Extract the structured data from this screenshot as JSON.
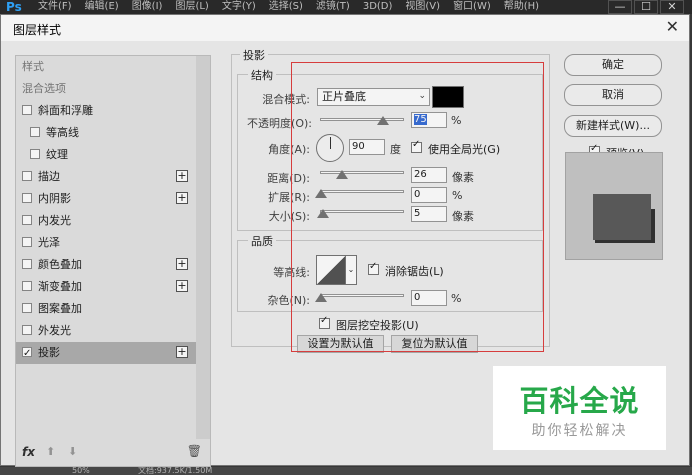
{
  "app": {
    "logo": "Ps",
    "menu": [
      "文件(F)",
      "编辑(E)",
      "图像(I)",
      "图层(L)",
      "文字(Y)",
      "选择(S)",
      "滤镜(T)",
      "3D(D)",
      "视图(V)",
      "窗口(W)",
      "帮助(H)"
    ],
    "window_buttons": [
      "—",
      "☐",
      "✕"
    ],
    "status_zoom": "50%",
    "status_doc": "文档:937.5K/1.50M"
  },
  "dialog": {
    "title": "图层样式",
    "close": "✕"
  },
  "left_panel": {
    "header": "样式",
    "blend": "混合选项",
    "items": [
      {
        "label": "斜面和浮雕",
        "checked": false
      },
      {
        "label": "等高线",
        "checked": false
      },
      {
        "label": "纹理",
        "checked": false
      },
      {
        "label": "描边",
        "checked": false,
        "plus": "+"
      },
      {
        "label": "内阴影",
        "checked": false,
        "plus": "+"
      },
      {
        "label": "内发光",
        "checked": false
      },
      {
        "label": "光泽",
        "checked": false
      },
      {
        "label": "颜色叠加",
        "checked": false,
        "plus": "+"
      },
      {
        "label": "渐变叠加",
        "checked": false,
        "plus": "+"
      },
      {
        "label": "图案叠加",
        "checked": false
      },
      {
        "label": "外发光",
        "checked": false
      },
      {
        "label": "投影",
        "checked": true,
        "plus": "+"
      }
    ],
    "bottom": {
      "fx": "fx",
      "up": "⬆",
      "down": "⬇",
      "trash": "🗑"
    }
  },
  "drop_shadow": {
    "section_title": "投影",
    "structure": {
      "title": "结构",
      "blend_mode_label": "混合模式:",
      "blend_mode_value": "正片叠底",
      "shadow_color": "#000000",
      "opacity_label": "不透明度(O):",
      "opacity_value": "75",
      "opacity_unit": "%",
      "angle_label": "角度(A):",
      "angle_value": "90",
      "angle_unit": "度",
      "global_light_label": "使用全局光(G)",
      "global_light_checked": true,
      "distance_label": "距离(D):",
      "distance_value": "26",
      "distance_unit": "像素",
      "spread_label": "扩展(R):",
      "spread_value": "0",
      "spread_unit": "%",
      "size_label": "大小(S):",
      "size_value": "5",
      "size_unit": "像素"
    },
    "quality": {
      "title": "品质",
      "contour_label": "等高线:",
      "antialias_label": "消除锯齿(L)",
      "antialias_checked": true,
      "noise_label": "杂色(N):",
      "noise_value": "0",
      "noise_unit": "%"
    },
    "knockout_label": "图层挖空投影(U)",
    "knockout_checked": true,
    "make_default": "设置为默认值",
    "reset_default": "复位为默认值"
  },
  "right": {
    "ok": "确定",
    "cancel": "取消",
    "new_style": "新建样式(W)...",
    "preview_label": "预览(V)",
    "preview_checked": true
  },
  "watermark": {
    "big": "百科全说",
    "small": "助你轻松解决"
  }
}
